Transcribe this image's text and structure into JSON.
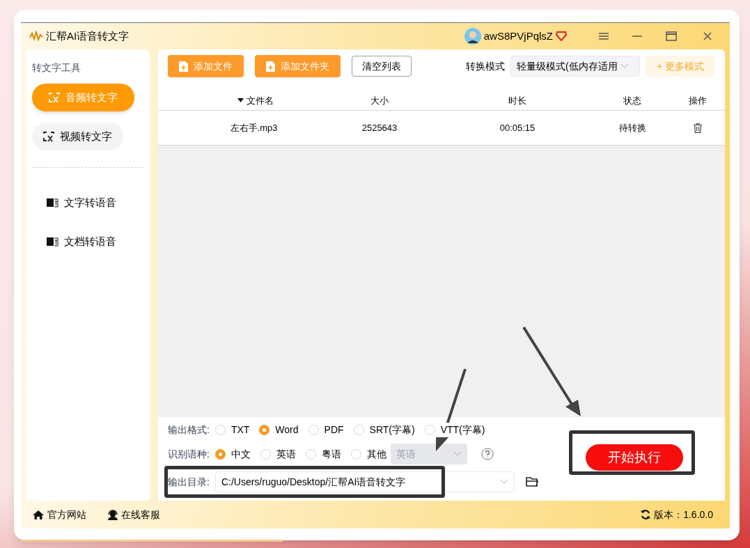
{
  "window": {
    "title": "汇帮AI语音转文字"
  },
  "user": {
    "name": "awS8PVjPqlsZ"
  },
  "sidebar": {
    "heading": "转文字工具",
    "items": [
      {
        "label": "音频转文字",
        "kind": "pill",
        "selected": true
      },
      {
        "label": "视频转文字",
        "kind": "pill",
        "selected": false
      },
      {
        "label": "文字转语音",
        "kind": "plain",
        "selected": false
      },
      {
        "label": "文档转语音",
        "kind": "plain",
        "selected": false
      }
    ]
  },
  "toolbar": {
    "buttons": [
      {
        "label": "添加文件",
        "kind": "primary"
      },
      {
        "label": "添加文件夹",
        "kind": "primary"
      },
      {
        "label": "清空列表",
        "kind": "outline"
      }
    ],
    "mode_label": "转换模式",
    "mode_value": "轻量级模式(低内存适用",
    "more_modes": "+ 更多模式"
  },
  "table": {
    "columns": [
      "文件名",
      "大小",
      "时长",
      "状态",
      "操作"
    ],
    "rows": [
      {
        "name": "左右手.mp3",
        "size": "2525643",
        "duration": "00:05:15",
        "status": "待转换"
      }
    ]
  },
  "output_format": {
    "label": "输出格式:",
    "options": [
      {
        "label": "TXT",
        "selected": false
      },
      {
        "label": "Word",
        "selected": true
      },
      {
        "label": "PDF",
        "selected": false
      },
      {
        "label": "SRT(字幕)",
        "selected": false
      },
      {
        "label": "VTT(字幕)",
        "selected": false
      }
    ]
  },
  "language": {
    "label": "识别语种:",
    "options": [
      {
        "label": "中文",
        "selected": true
      },
      {
        "label": "英语",
        "selected": false
      },
      {
        "label": "粤语",
        "selected": false
      },
      {
        "label": "其他",
        "selected": false
      }
    ],
    "other_value": "英语",
    "other_disabled": true
  },
  "output_dir": {
    "label": "输出目录:",
    "value": "C:/Users/ruguo/Desktop/汇帮AI语音转文字"
  },
  "start_button": "开始执行",
  "footer": {
    "links": [
      "官方网站",
      "在线客服"
    ],
    "version": "版本：1.6.0.0"
  }
}
